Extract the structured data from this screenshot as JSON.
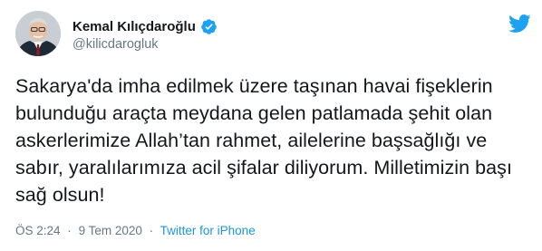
{
  "tweet": {
    "display_name": "Kemal Kılıçdaroğlu",
    "handle": "@kilicdarogluk",
    "verified_icon": "verified-badge-icon",
    "brand_icon": "twitter-bird-icon",
    "text": "Sakarya'da imha edilmek üzere taşınan havai fişeklerin bulunduğu araçta meydana gelen patlamada şehit olan askerlerimize Allah’tan rahmet, ailelerine başsağlığı ve sabır, yaralılarımıza acil şifalar diliyorum. Milletimizin başı sağ olsun!",
    "time": "ÖS 2:24",
    "date": "9 Tem 2020",
    "separator": "·",
    "source": "Twitter for iPhone"
  },
  "colors": {
    "accent": "#1da1f2",
    "link": "#1b95e0",
    "muted": "#657786",
    "text": "#14171a"
  }
}
